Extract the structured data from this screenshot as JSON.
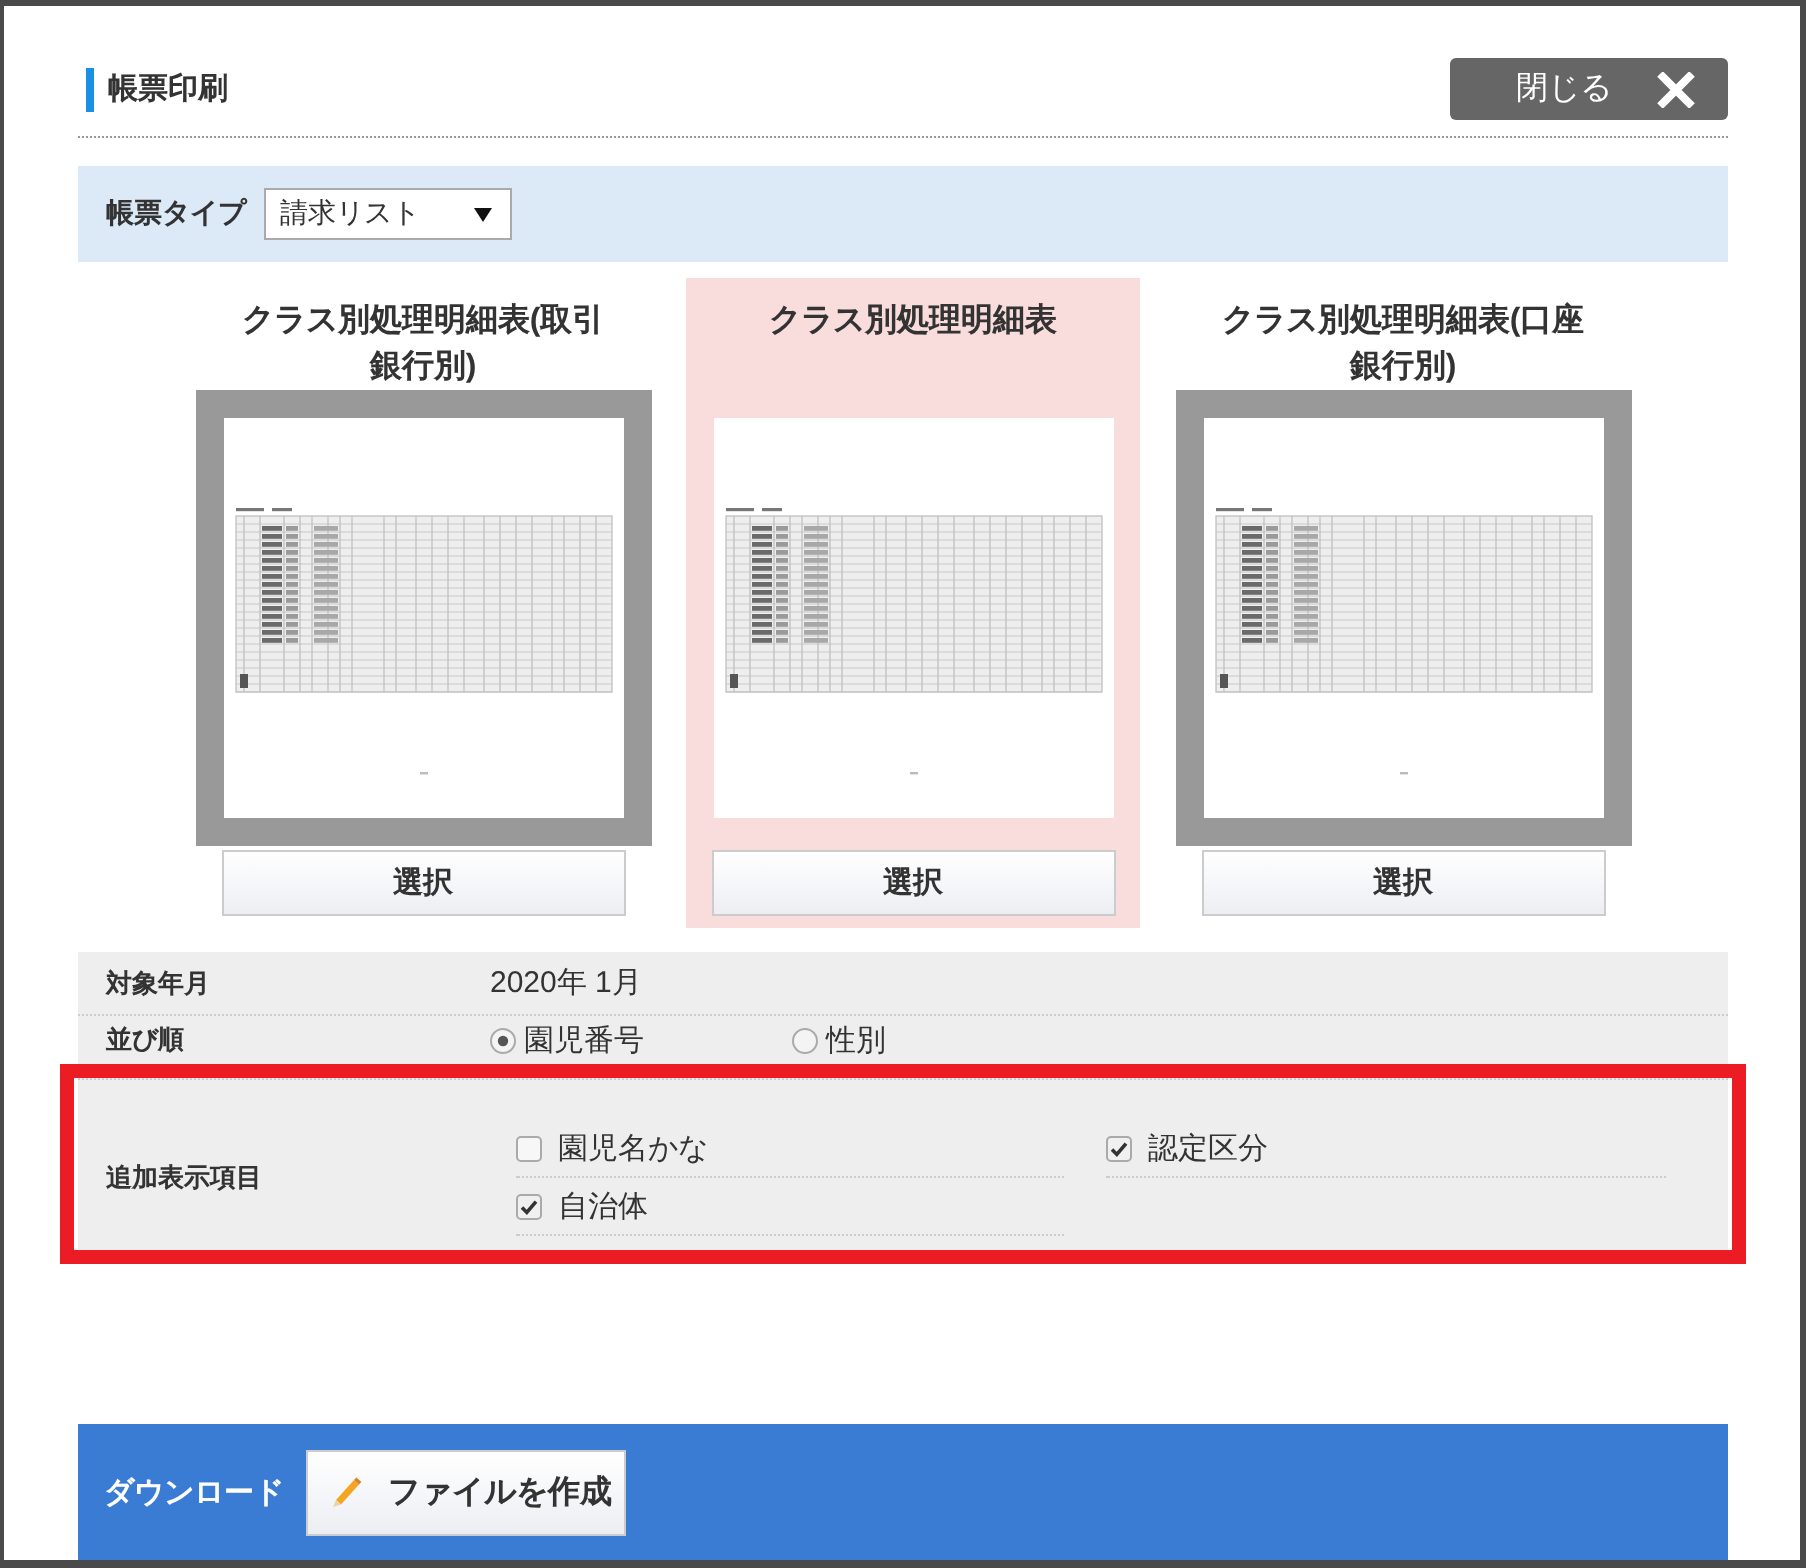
{
  "dialog": {
    "title": "帳票印刷",
    "close_button": "閉じる"
  },
  "report_type": {
    "label": "帳票タイプ",
    "value": "請求リスト"
  },
  "cards": [
    {
      "title": "クラス別処理明細表(取引銀行別)",
      "selected": false,
      "button": "選択"
    },
    {
      "title": "クラス別処理明細表",
      "selected": true,
      "button": "選択"
    },
    {
      "title": "クラス別処理明細表(口座銀行別)",
      "selected": false,
      "button": "選択"
    }
  ],
  "settings": [
    {
      "kind": "text",
      "label": "対象年月",
      "value": "2020年 1月",
      "highlighted": false
    },
    {
      "kind": "radio",
      "label": "並び順",
      "highlighted": false,
      "options": [
        {
          "label": "園児番号",
          "selected": true
        },
        {
          "label": "性別",
          "selected": false
        }
      ]
    },
    {
      "kind": "checkbox",
      "label": "追加表示項目",
      "highlighted": true,
      "options": [
        {
          "label": "園児名かな",
          "checked": false
        },
        {
          "label": "認定区分",
          "checked": true
        },
        {
          "label": "自治体",
          "checked": true
        }
      ]
    }
  ],
  "download": {
    "label": "ダウンロード",
    "button": "ファイルを作成"
  }
}
